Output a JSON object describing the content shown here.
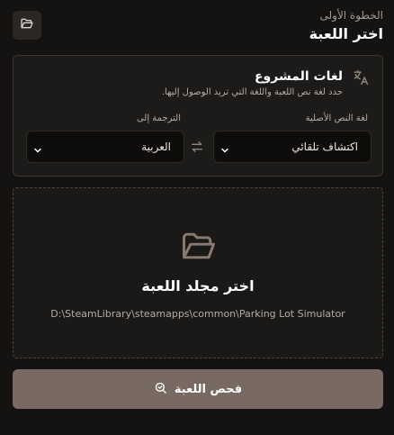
{
  "header": {
    "step_label": "الخطوة الأولى",
    "title": "اختر اللعبة",
    "folder_icon": "folder-icon"
  },
  "languages": {
    "title": "لغات المشروع",
    "description": "حدد لغة نص اللعبة واللغة التي تريد الوصول إليها.",
    "icon": "translate-icon",
    "source": {
      "label": "لغة النص الأصلية",
      "value": "اكتشاف تلقائي"
    },
    "target": {
      "label": "الترجمة إلى",
      "value": "العربية"
    },
    "swap_icon": "swap-icon"
  },
  "drop_zone": {
    "icon": "folder-open-icon",
    "title": "اختر مجلد اللعبة",
    "path": "D:\\SteamLibrary\\steamapps\\common\\Parking Lot Simulator"
  },
  "scan_button": {
    "label": "فحص اللعبة",
    "icon": "search-check-icon"
  },
  "colors": {
    "background": "#141312",
    "card": "#1d1b19",
    "accent_button": "#786a62"
  }
}
